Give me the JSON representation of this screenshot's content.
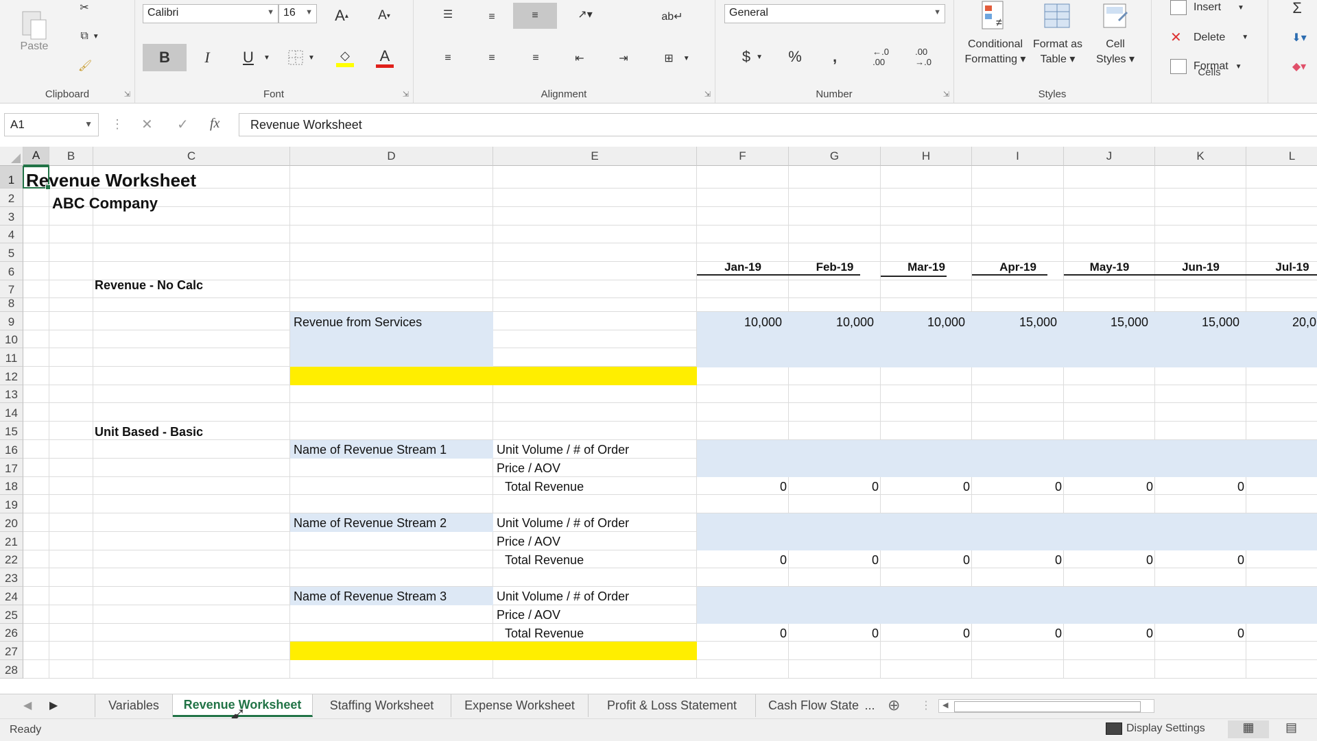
{
  "ribbon": {
    "clipboard": {
      "label": "Clipboard",
      "paste_label": "Paste"
    },
    "font": {
      "label": "Font",
      "family": "Calibri",
      "size": "16",
      "bold": "B",
      "italic": "I",
      "underline": "U",
      "font_color": "#e0201b",
      "highlight_color": "#ffff00"
    },
    "alignment": {
      "label": "Alignment"
    },
    "number": {
      "label": "Number",
      "format": "General",
      "currency": "$",
      "percent": "%",
      "comma": ",",
      "inc_dec": "←.0\n.00",
      "dec_dec": ".00\n→.0"
    },
    "styles": {
      "label": "Styles",
      "conditional_1": "Conditional",
      "conditional_2": "Formatting",
      "format_table_1": "Format as",
      "format_table_2": "Table",
      "cell_styles_1": "Cell",
      "cell_styles_2": "Styles"
    },
    "cells": {
      "label": "Cells",
      "insert": "Insert",
      "delete": "Delete",
      "format": "Format"
    },
    "editing": {
      "autosum": "Σ"
    }
  },
  "formula_bar": {
    "name_box": "A1",
    "fx": "fx",
    "cancel": "✕",
    "enter": "✓",
    "content": "Revenue Worksheet"
  },
  "columns": [
    "A",
    "B",
    "C",
    "D",
    "E",
    "F",
    "G",
    "H",
    "I",
    "J",
    "K",
    "L"
  ],
  "rows": [
    "1",
    "2",
    "3",
    "4",
    "5",
    "6",
    "7",
    "8",
    "9",
    "10",
    "11",
    "12",
    "13",
    "14",
    "15",
    "16",
    "17",
    "18",
    "19",
    "20",
    "21",
    "22",
    "23",
    "24",
    "25",
    "26",
    "27",
    "28"
  ],
  "cells": {
    "title": "Revenue Worksheet",
    "company": "ABC Company",
    "months": [
      "Jan-19",
      "Feb-19",
      "Mar-19",
      "Apr-19",
      "May-19",
      "Jun-19",
      "Jul-19"
    ],
    "section_no_calc": "Revenue - No Calc",
    "revenue_services": "Revenue from Services",
    "services_values": [
      "10,000",
      "10,000",
      "10,000",
      "15,000",
      "15,000",
      "15,000",
      "20,0"
    ],
    "section_unit": "Unit Based - Basic",
    "streams": [
      {
        "name": "Name of Revenue Stream 1",
        "volume": "Unit Volume / # of Order",
        "price": "Price / AOV",
        "total": "Total Revenue",
        "totals": [
          "0",
          "0",
          "0",
          "0",
          "0",
          "0"
        ]
      },
      {
        "name": "Name of Revenue Stream 2",
        "volume": "Unit Volume / # of Order",
        "price": "Price / AOV",
        "total": "Total Revenue",
        "totals": [
          "0",
          "0",
          "0",
          "0",
          "0",
          "0"
        ]
      },
      {
        "name": "Name of Revenue Stream 3",
        "volume": "Unit Volume / # of Order",
        "price": "Price / AOV",
        "total": "Total Revenue",
        "totals": [
          "0",
          "0",
          "0",
          "0",
          "0",
          "0"
        ]
      }
    ],
    "input_fill_color": "#dde8f5",
    "highlight_fill_color": "#ffee00"
  },
  "tabs": [
    "Variables",
    "Revenue Worksheet",
    "Staffing Worksheet",
    "Expense Worksheet",
    "Profit & Loss Statement",
    "Cash Flow State"
  ],
  "active_tab": "Revenue Worksheet",
  "tab_overflow": "...",
  "status": {
    "ready": "Ready",
    "display_settings": "Display Settings"
  },
  "accent_color": "#217346"
}
